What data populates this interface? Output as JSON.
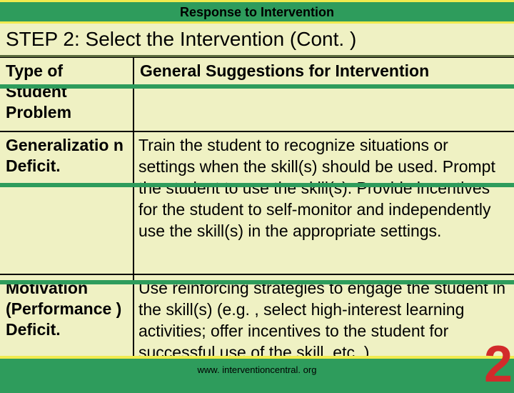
{
  "header": {
    "title": "Response to Intervention"
  },
  "step": {
    "heading": "STEP 2: Select the Intervention (Cont. )"
  },
  "table": {
    "head": {
      "left": "Type of Student Problem",
      "right": "General Suggestions for Intervention"
    },
    "rows": [
      {
        "left": "Generalizatio n Deficit.",
        "right": "Train the student to recognize situations or settings when the skill(s) should be used. Prompt the student to use the skill(s). Provide incentives for the student to self-monitor and independently use the skill(s) in the appropriate settings."
      },
      {
        "left": "Motivation (Performance ) Deficit.",
        "right": "Use reinforcing strategies to engage the student in the skill(s) (e.g. , select high-interest learning activities; offer incentives to the student for successful use of the skill, etc. )."
      }
    ]
  },
  "footer": {
    "url": "www. interventioncentral. org"
  },
  "page_number": "2"
}
